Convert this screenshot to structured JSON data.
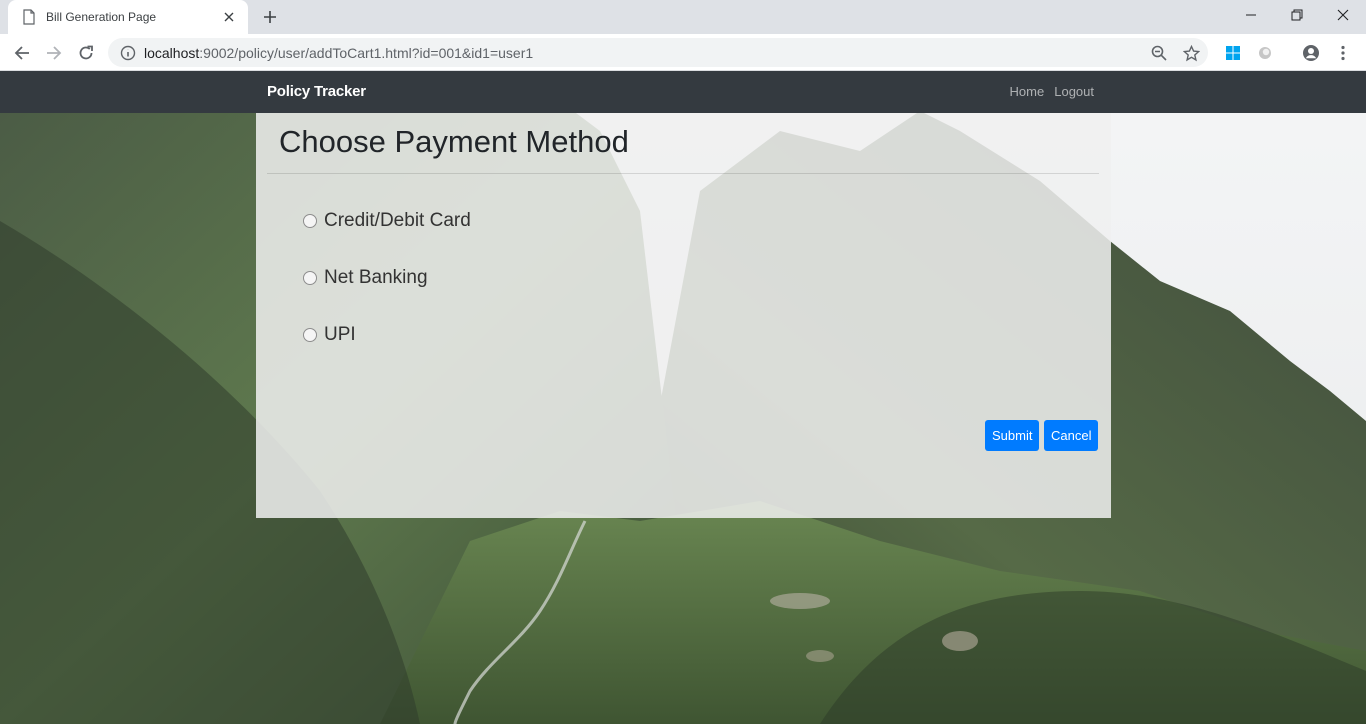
{
  "browser": {
    "tab_title": "Bill Generation Page",
    "url_host": "localhost",
    "url_rest": ":9002/policy/user/addToCart1.html?id=001&id1=user1"
  },
  "navbar": {
    "brand": "Policy Tracker",
    "links": [
      "Home",
      "Logout"
    ]
  },
  "payment": {
    "heading": "Choose Payment Method",
    "options": [
      "Credit/Debit Card",
      "Net Banking",
      "UPI"
    ],
    "selected": null,
    "submit_label": "Submit",
    "cancel_label": "Cancel"
  },
  "colors": {
    "navbar_bg": "#343a40",
    "button_primary": "#007bff"
  }
}
